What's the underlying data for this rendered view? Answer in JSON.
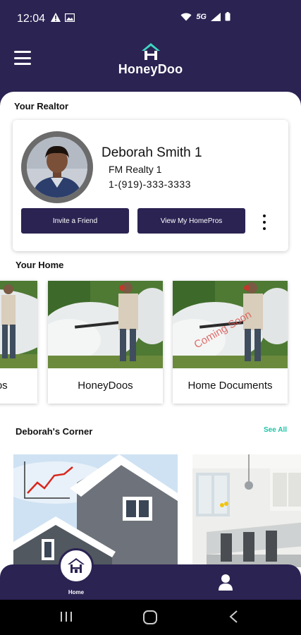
{
  "status_bar": {
    "time": "12:04",
    "network": "5G"
  },
  "app": {
    "name": "HoneyDoo"
  },
  "realtor_section": {
    "title": "Your Realtor",
    "name": "Deborah Smith 1",
    "company": "FM Realty 1",
    "phone": "1-(919)-333-3333",
    "invite_label": "Invite a Friend",
    "homepros_label": "View My HomePros"
  },
  "home_section": {
    "title": "Your Home",
    "tiles": [
      {
        "label": "HoneyDoos",
        "overlay": ""
      },
      {
        "label": "HoneyDoos",
        "overlay": ""
      },
      {
        "label": "Home Documents",
        "overlay": "Coming Soon"
      }
    ]
  },
  "corner_section": {
    "title": "Deborah's Corner",
    "see_all": "See All"
  },
  "bottom_nav": {
    "home_label": "Home"
  },
  "colors": {
    "primary": "#2b2352",
    "accent": "#1ec3a6",
    "ring": "#6b6b6b"
  }
}
